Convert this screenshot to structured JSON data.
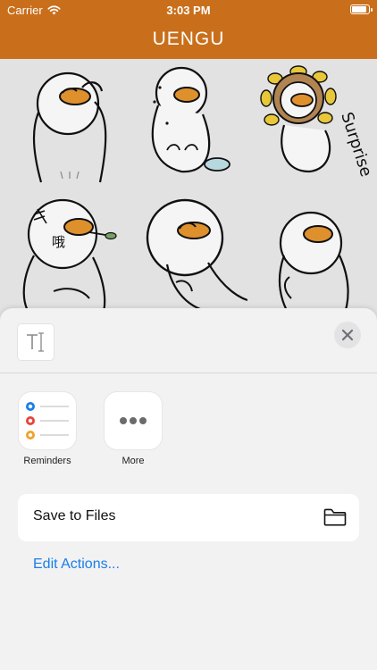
{
  "status": {
    "carrier": "Carrier",
    "time": "3:03 PM",
    "battery_level": 0.9
  },
  "nav": {
    "title": "UENGU"
  },
  "stickers": [
    {
      "name": "duck-thinking"
    },
    {
      "name": "duck-sitting-bowl"
    },
    {
      "name": "duck-surprise",
      "caption": "Surprise"
    },
    {
      "name": "duck-leaf",
      "caption": "哦"
    },
    {
      "name": "duck-shy"
    },
    {
      "name": "duck-pointing"
    }
  ],
  "share": {
    "close_icon": "close-icon",
    "actions": [
      {
        "label": "Reminders",
        "icon": "reminders-icon"
      },
      {
        "label": "More",
        "icon": "more-icon"
      }
    ],
    "save_to_files": "Save to Files",
    "edit_actions": "Edit Actions..."
  },
  "colors": {
    "brand": "#c96f1b",
    "duck_bill": "#e8962f",
    "link": "#1a7ee8",
    "sunflower": "#f2d03b"
  }
}
